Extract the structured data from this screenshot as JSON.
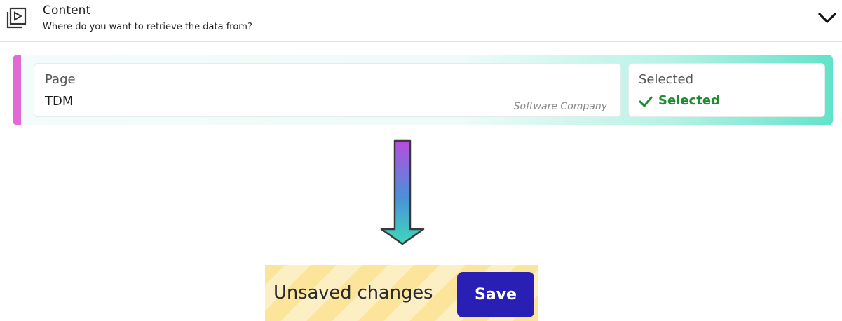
{
  "header": {
    "title": "Content",
    "subtitle": "Where do you want to retrieve the data from?",
    "icon": "video-library-icon",
    "toggle_icon": "chevron-down-icon"
  },
  "card": {
    "accent_color": "#e369d5",
    "page_field": {
      "label": "Page",
      "value": "TDM",
      "hint": "Software Company"
    },
    "selected_field": {
      "label": "Selected",
      "value": "Selected",
      "icon": "check-icon",
      "status_color": "#1f8a30"
    }
  },
  "arrow": {
    "icon": "arrow-down-icon",
    "gradient": [
      "#b64de0",
      "#4a90d9",
      "#3fd9b8"
    ]
  },
  "unsaved_bar": {
    "text": "Unsaved changes",
    "save_label": "Save",
    "save_color": "#2a1fb4"
  }
}
